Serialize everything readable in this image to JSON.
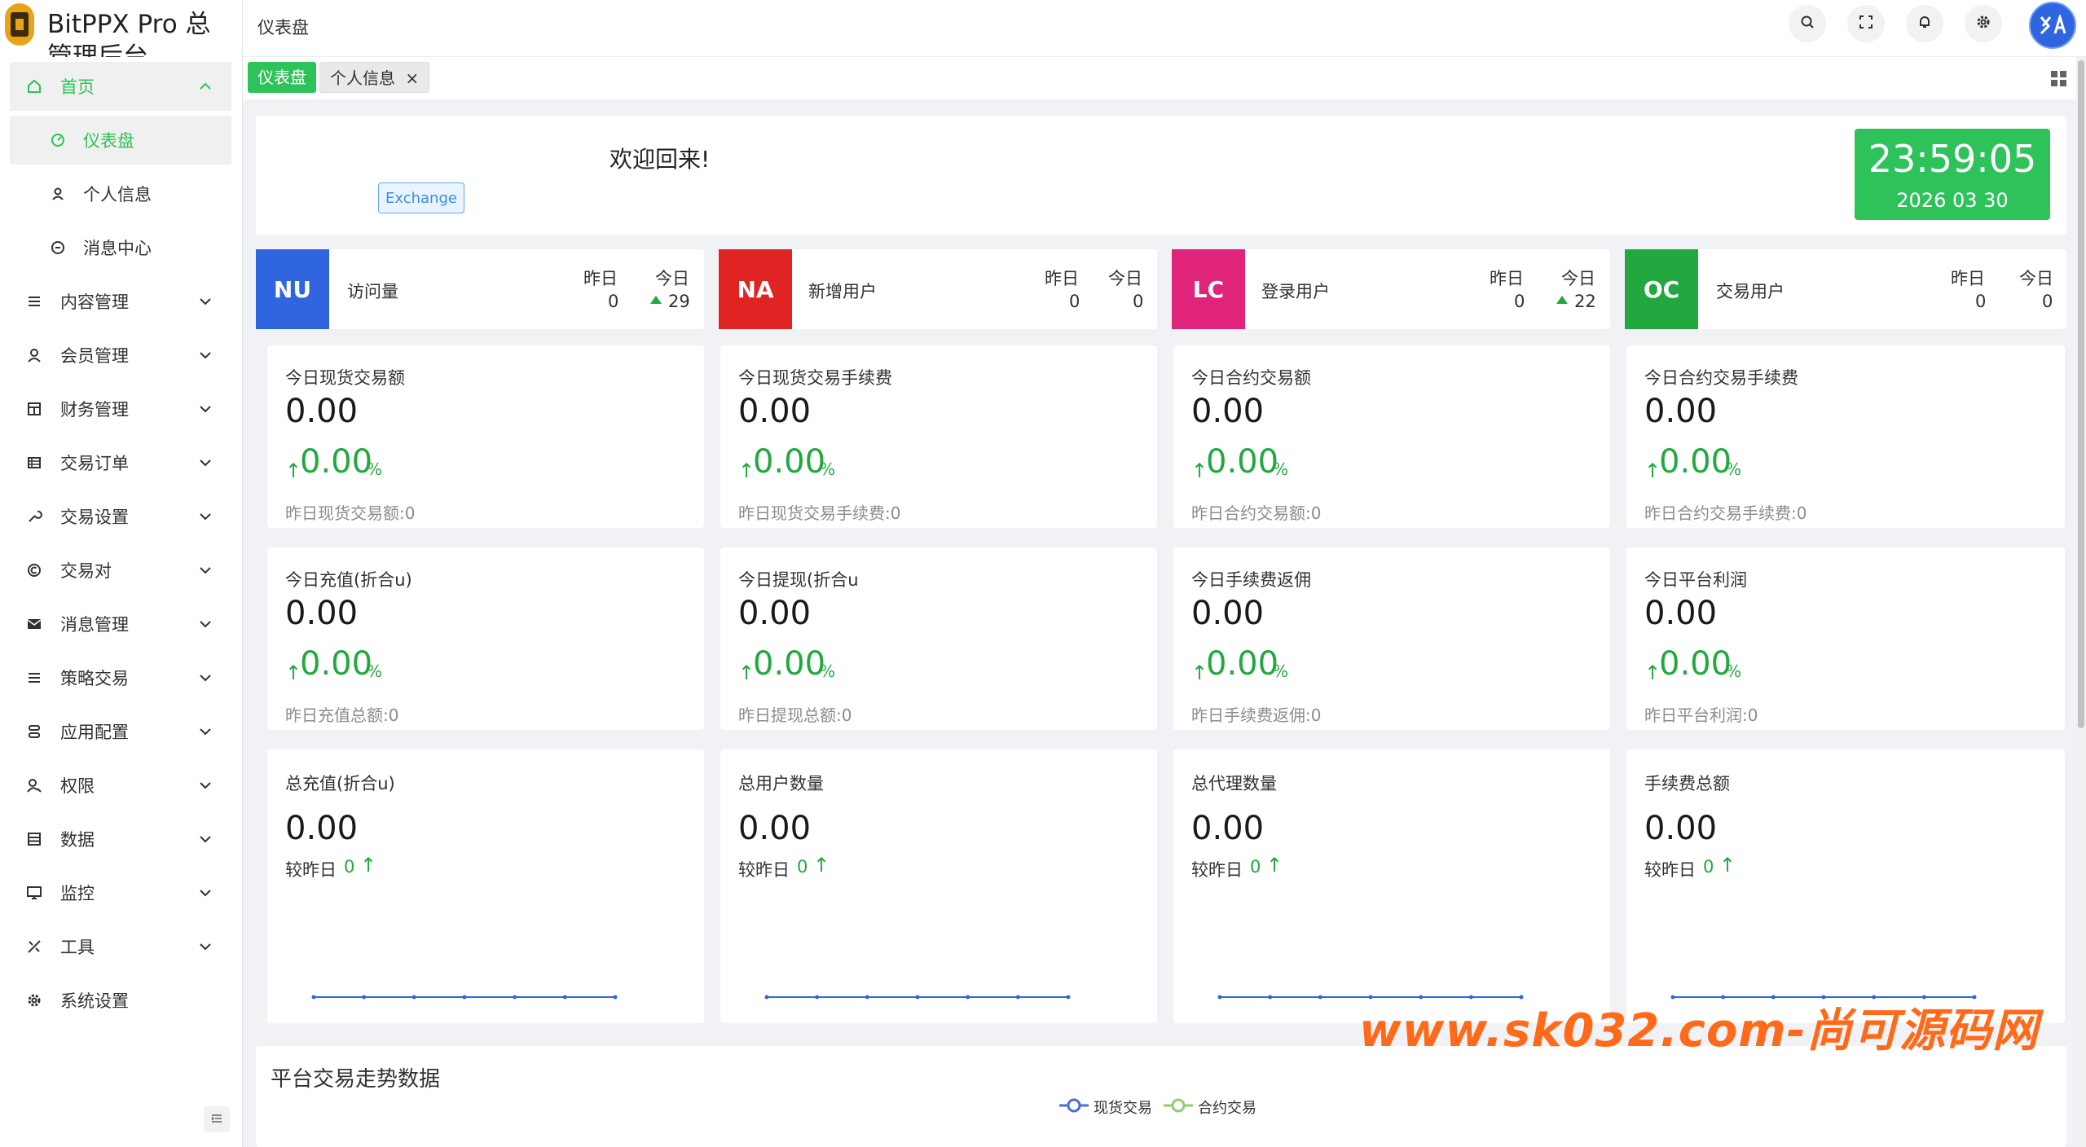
{
  "app": {
    "title": "BitPPX Pro 总管理后台"
  },
  "header": {
    "breadcrumb": "仪表盘"
  },
  "tags": [
    {
      "label": "仪表盘"
    },
    {
      "label": "个人信息"
    }
  ],
  "sidebar": {
    "home": "首页",
    "sub": [
      "仪表盘",
      "个人信息",
      "消息中心"
    ],
    "items": [
      "内容管理",
      "会员管理",
      "财务管理",
      "交易订单",
      "交易设置",
      "交易对",
      "消息管理",
      "策略交易",
      "应用配置",
      "权限",
      "数据",
      "监控",
      "工具",
      "系统设置"
    ]
  },
  "welcome": {
    "text": "欢迎回来!",
    "button": "Exchange"
  },
  "clock": {
    "time": "23:59:05",
    "date": "2026 03 30"
  },
  "stats": [
    {
      "badge": "NU",
      "label": "访问量",
      "y_label": "昨日",
      "y_val": "0",
      "t_label": "今日",
      "t_val": "29",
      "color": "#2f66e0"
    },
    {
      "badge": "NA",
      "label": "新增用户",
      "y_label": "昨日",
      "y_val": "0",
      "t_label": "今日",
      "t_val": "0",
      "color": "#e02424"
    },
    {
      "badge": "LC",
      "label": "登录用户",
      "y_label": "昨日",
      "y_val": "0",
      "t_label": "今日",
      "t_val": "22",
      "color": "#e0247c"
    },
    {
      "badge": "OC",
      "label": "交易用户",
      "y_label": "昨日",
      "y_val": "0",
      "t_label": "今日",
      "t_val": "0",
      "color": "#22a83f"
    }
  ],
  "metrics": [
    {
      "title": "今日现货交易额",
      "value": "0.00",
      "pct": "0.00",
      "unit": "%",
      "sub": "昨日现货交易额:0"
    },
    {
      "title": "今日现货交易手续费",
      "value": "0.00",
      "pct": "0.00",
      "unit": "%",
      "sub": "昨日现货交易手续费:0"
    },
    {
      "title": "今日合约交易额",
      "value": "0.00",
      "pct": "0.00",
      "unit": "%",
      "sub": "昨日合约交易额:0"
    },
    {
      "title": "今日合约交易手续费",
      "value": "0.00",
      "pct": "0.00",
      "unit": "%",
      "sub": "昨日合约交易手续费:0"
    },
    {
      "title": "今日充值(折合u)",
      "value": "0.00",
      "pct": "0.00",
      "unit": "%",
      "sub": "昨日充值总额:0"
    },
    {
      "title": "今日提现(折合u",
      "value": "0.00",
      "pct": "0.00",
      "unit": "%",
      "sub": "昨日提现总额:0"
    },
    {
      "title": "今日手续费返佣",
      "value": "0.00",
      "pct": "0.00",
      "unit": "%",
      "sub": "昨日手续费返佣:0"
    },
    {
      "title": "今日平台利润",
      "value": "0.00",
      "pct": "0.00",
      "unit": "%",
      "sub": "昨日平台利润:0"
    }
  ],
  "totals": [
    {
      "title": "总充值(折合u)",
      "value": "0.00",
      "cmp": "较昨日",
      "cmp_val": "0"
    },
    {
      "title": "总用户数量",
      "value": "0.00",
      "cmp": "较昨日",
      "cmp_val": "0"
    },
    {
      "title": "总代理数量",
      "value": "0.00",
      "cmp": "较昨日",
      "cmp_val": "0"
    },
    {
      "title": "手续费总额",
      "value": "0.00",
      "cmp": "较昨日",
      "cmp_val": "0"
    }
  ],
  "sparkline": {
    "values": [
      0,
      0,
      0,
      0,
      0,
      0,
      0
    ],
    "color": "#2f66e0"
  },
  "trend": {
    "title": "平台交易走势数据",
    "legend": [
      {
        "name": "现货交易",
        "color": "#4a6fd6"
      },
      {
        "name": "合约交易",
        "color": "#8fcf6a"
      }
    ]
  },
  "watermark": "www.sk032.com-尚可源码网"
}
